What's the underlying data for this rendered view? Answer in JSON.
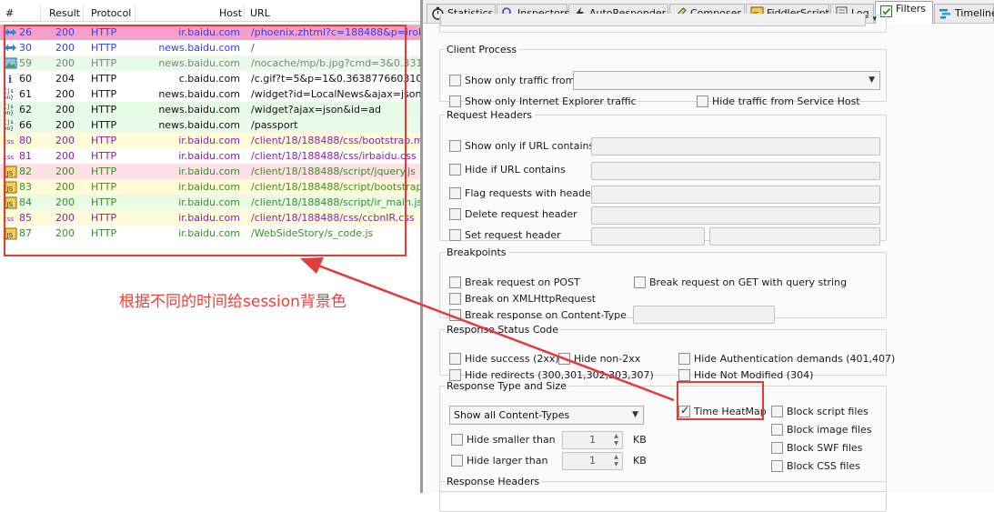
{
  "sessions": {
    "columns": [
      "#",
      "Result",
      "Protocol",
      "Host",
      "URL"
    ],
    "rows": [
      {
        "num": "26",
        "result": "200",
        "protocol": "HTTP",
        "host": "ir.baidu.com",
        "url": "/phoenix.zhtml?c=188488&p=irol-irhom",
        "icon": "redirect-icon",
        "bg": "#f79fcb",
        "fg": "#3440e3"
      },
      {
        "num": "30",
        "result": "200",
        "protocol": "HTTP",
        "host": "news.baidu.com",
        "url": "/",
        "icon": "redirect-icon",
        "bg": "#ffffff",
        "fg": "#3440e3"
      },
      {
        "num": "59",
        "result": "200",
        "protocol": "HTTP",
        "host": "news.baidu.com",
        "url": "/nocache/mp/b.jpg?cmd=3&0.331206",
        "icon": "image-icon",
        "bg": "#e8fbe8",
        "fg": "#7f7f7f"
      },
      {
        "num": "60",
        "result": "204",
        "protocol": "HTTP",
        "host": "c.baidu.com",
        "url": "/c.gif?t=5&p=1&0.363877660310892",
        "icon": "info-icon",
        "bg": "#ffffff",
        "fg": "#111111"
      },
      {
        "num": "61",
        "result": "200",
        "protocol": "HTTP",
        "host": "news.baidu.com",
        "url": "/widget?id=LocalNews&ajax=json&t=",
        "icon": "json-icon",
        "bg": "#ffffff",
        "fg": "#111111"
      },
      {
        "num": "62",
        "result": "200",
        "protocol": "HTTP",
        "host": "news.baidu.com",
        "url": "/widget?ajax=json&id=ad",
        "icon": "json-icon",
        "bg": "#e6fbe6",
        "fg": "#111111"
      },
      {
        "num": "66",
        "result": "200",
        "protocol": "HTTP",
        "host": "news.baidu.com",
        "url": "/passport",
        "icon": "json-icon",
        "bg": "#ebfbe9",
        "fg": "#111111"
      },
      {
        "num": "80",
        "result": "200",
        "protocol": "HTTP",
        "host": "ir.baidu.com",
        "url": "/client/18/188488/css/bootstrap.min.c",
        "icon": "css-icon",
        "bg": "#fffcd9",
        "fg": "#8c1fa8"
      },
      {
        "num": "81",
        "result": "200",
        "protocol": "HTTP",
        "host": "ir.baidu.com",
        "url": "/client/18/188488/css/irbaidu.css",
        "icon": "css-icon",
        "bg": "#ffffff",
        "fg": "#8c1fa8"
      },
      {
        "num": "82",
        "result": "200",
        "protocol": "HTTP",
        "host": "ir.baidu.com",
        "url": "/client/18/188488/script/jquery.js",
        "icon": "js-icon",
        "bg": "#fde1e6",
        "fg": "#3b8d2c"
      },
      {
        "num": "83",
        "result": "200",
        "protocol": "HTTP",
        "host": "ir.baidu.com",
        "url": "/client/18/188488/script/bootstrap.min",
        "icon": "js-icon",
        "bg": "#fffbd6",
        "fg": "#3b8d2c"
      },
      {
        "num": "84",
        "result": "200",
        "protocol": "HTTP",
        "host": "ir.baidu.com",
        "url": "/client/18/188488/script/ir_main.js",
        "icon": "js-icon",
        "bg": "#ebfbe5",
        "fg": "#3b8d2c"
      },
      {
        "num": "85",
        "result": "200",
        "protocol": "HTTP",
        "host": "ir.baidu.com",
        "url": "/client/18/188488/css/ccbnIR.css",
        "icon": "css-icon",
        "bg": "#fffcd9",
        "fg": "#8c1fa8"
      },
      {
        "num": "87",
        "result": "200",
        "protocol": "HTTP",
        "host": "ir.baidu.com",
        "url": "/WebSideStory/s_code.js",
        "icon": "js-icon",
        "bg": "#ffffff",
        "fg": "#3b8d2c"
      }
    ]
  },
  "annotation": "根据不同的时间给session背景色",
  "accent_red": "#e23b3b",
  "tabs": [
    {
      "label": "Statistics",
      "icon": "stopwatch-icon"
    },
    {
      "label": "Inspectors",
      "icon": "inspectors-icon"
    },
    {
      "label": "AutoResponder",
      "icon": "lightning-icon"
    },
    {
      "label": "Composer",
      "icon": "pencil-icon"
    },
    {
      "label": "FiddlerScript",
      "icon": "script-icon"
    },
    {
      "label": "Log",
      "icon": "log-icon"
    },
    {
      "label": "Filters",
      "icon": "checkbox-icon",
      "active": true
    },
    {
      "label": "Timeline",
      "icon": "timeline-icon"
    }
  ],
  "filters": {
    "client_process": {
      "legend": "Client Process",
      "show_only_traffic_from": "Show only traffic from",
      "show_only_ie": "Show only Internet Explorer traffic",
      "hide_service_host": "Hide traffic from Service Host"
    },
    "request_headers": {
      "legend": "Request Headers",
      "show_only_url": "Show only if URL contains",
      "hide_url": "Hide if URL contains",
      "flag_headers": "Flag requests with headers",
      "delete_header": "Delete request header",
      "set_header": "Set request header"
    },
    "breakpoints": {
      "legend": "Breakpoints",
      "break_post": "Break request on POST",
      "break_get_qs": "Break request on GET with query string",
      "break_xhr": "Break on XMLHttpRequest",
      "break_content_type": "Break response on Content-Type"
    },
    "response_status": {
      "legend": "Response Status Code",
      "hide_success": "Hide success (2xx)",
      "hide_non2xx": "Hide non-2xx",
      "hide_auth": "Hide Authentication demands (401,407)",
      "hide_redirects": "Hide redirects (300,301,302,303,307)",
      "hide_not_modified": "Hide Not Modified (304)"
    },
    "response_type": {
      "legend": "Response Type and Size",
      "content_types": "Show all Content-Types",
      "time_heatmap": "Time HeatMap",
      "time_heatmap_checked": true,
      "hide_smaller": "Hide smaller than",
      "hide_larger": "Hide larger than",
      "smaller_value": "1",
      "larger_value": "1",
      "unit": "KB",
      "block_script": "Block script files",
      "block_image": "Block image files",
      "block_swf": "Block SWF files",
      "block_css": "Block CSS files"
    },
    "response_headers": {
      "legend": "Response Headers"
    }
  }
}
